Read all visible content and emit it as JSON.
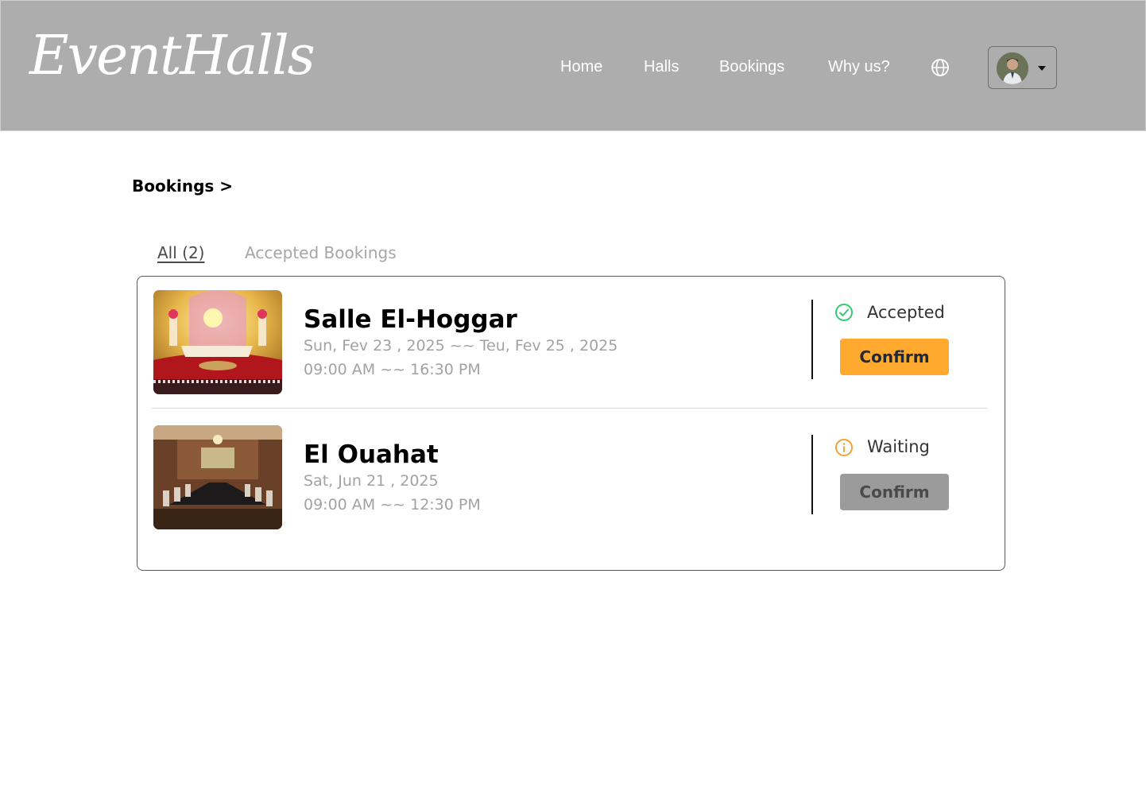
{
  "header": {
    "logo_text": "EventHalls",
    "nav": [
      "Home",
      "Halls",
      "Bookings",
      "Why us?"
    ],
    "globe_icon": "globe-icon",
    "profile_icon": "avatar",
    "colors": {
      "header_bg": "#acadac",
      "nav_text": "#ffffff"
    }
  },
  "breadcrumb": {
    "label": "Bookings >"
  },
  "tabs": [
    {
      "label": "All  (2)",
      "active": true
    },
    {
      "label": "Accepted Bookings",
      "active": false
    }
  ],
  "bookings": [
    {
      "name": "Salle El-Hoggar",
      "dates": "Sun, Fev 23 , 2025 ~~ Teu, Fev 25 , 2025",
      "time": "09:00 AM ~~ 16:30 PM",
      "status": "Accepted",
      "status_icon": "check-circle-icon",
      "status_color": "#2ecc71",
      "button": "Confirm",
      "button_color": "#ffa92f"
    },
    {
      "name": "El Ouahat",
      "dates": "Sat, Jun 21 , 2025",
      "time": "09:00 AM ~~ 12:30 PM",
      "status": "Waiting",
      "status_icon": "info-circle-icon",
      "status_color": "#f2a13b",
      "button": "Confirm",
      "button_color": "#9b9b9b"
    }
  ]
}
